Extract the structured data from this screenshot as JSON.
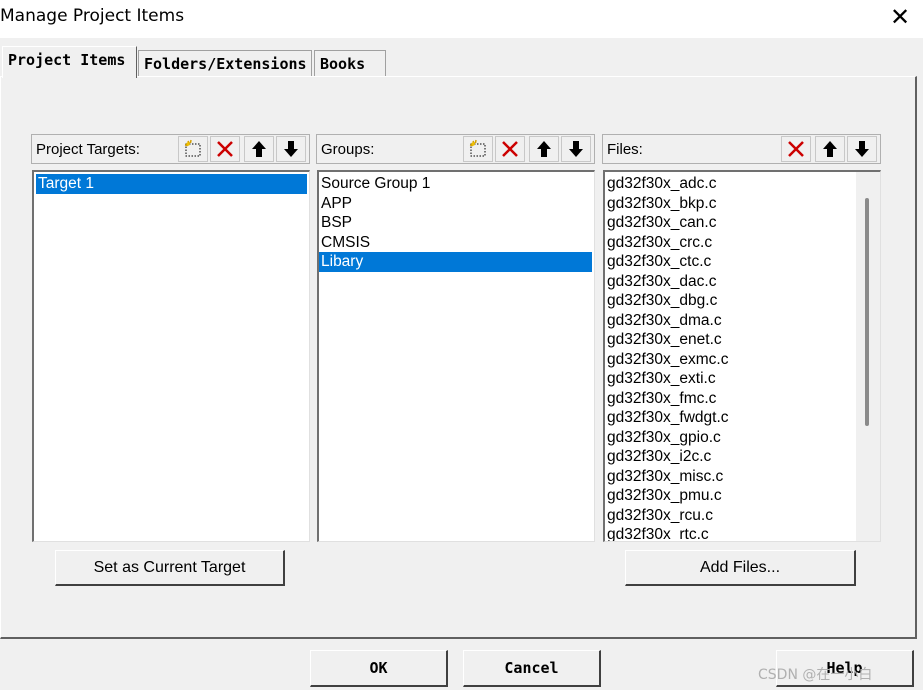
{
  "window": {
    "title": "Manage Project Items",
    "close_glyph": "✕"
  },
  "tabs": [
    {
      "label": "Project Items",
      "active": true
    },
    {
      "label": "Folders/Extensions",
      "active": false
    },
    {
      "label": "Books",
      "active": false
    }
  ],
  "targets": {
    "label": "Project Targets:",
    "items": [
      "Target 1"
    ],
    "selected": "Target 1",
    "toolbar": [
      "new-icon",
      "delete-icon",
      "move-up-icon",
      "move-down-icon"
    ],
    "set_current_label": "Set as Current Target"
  },
  "groups": {
    "label": "Groups:",
    "items": [
      "Source Group 1",
      "APP",
      "BSP",
      "CMSIS",
      "Libary"
    ],
    "selected": "Libary",
    "toolbar": [
      "new-icon",
      "delete-icon",
      "move-up-icon",
      "move-down-icon"
    ]
  },
  "files": {
    "label": "Files:",
    "items": [
      "gd32f30x_adc.c",
      "gd32f30x_bkp.c",
      "gd32f30x_can.c",
      "gd32f30x_crc.c",
      "gd32f30x_ctc.c",
      "gd32f30x_dac.c",
      "gd32f30x_dbg.c",
      "gd32f30x_dma.c",
      "gd32f30x_enet.c",
      "gd32f30x_exmc.c",
      "gd32f30x_exti.c",
      "gd32f30x_fmc.c",
      "gd32f30x_fwdgt.c",
      "gd32f30x_gpio.c",
      "gd32f30x_i2c.c",
      "gd32f30x_misc.c",
      "gd32f30x_pmu.c",
      "gd32f30x_rcu.c",
      "gd32f30x_rtc.c"
    ],
    "toolbar": [
      "delete-icon",
      "move-up-icon",
      "move-down-icon"
    ],
    "add_files_label": "Add Files..."
  },
  "dialog_buttons": {
    "ok": "OK",
    "cancel": "Cancel",
    "help": "Help"
  },
  "watermark": "CSDN @在一小白",
  "colors": {
    "selection": "#0078d7",
    "delete_red": "#cc0000",
    "face": "#f0f0f0"
  }
}
